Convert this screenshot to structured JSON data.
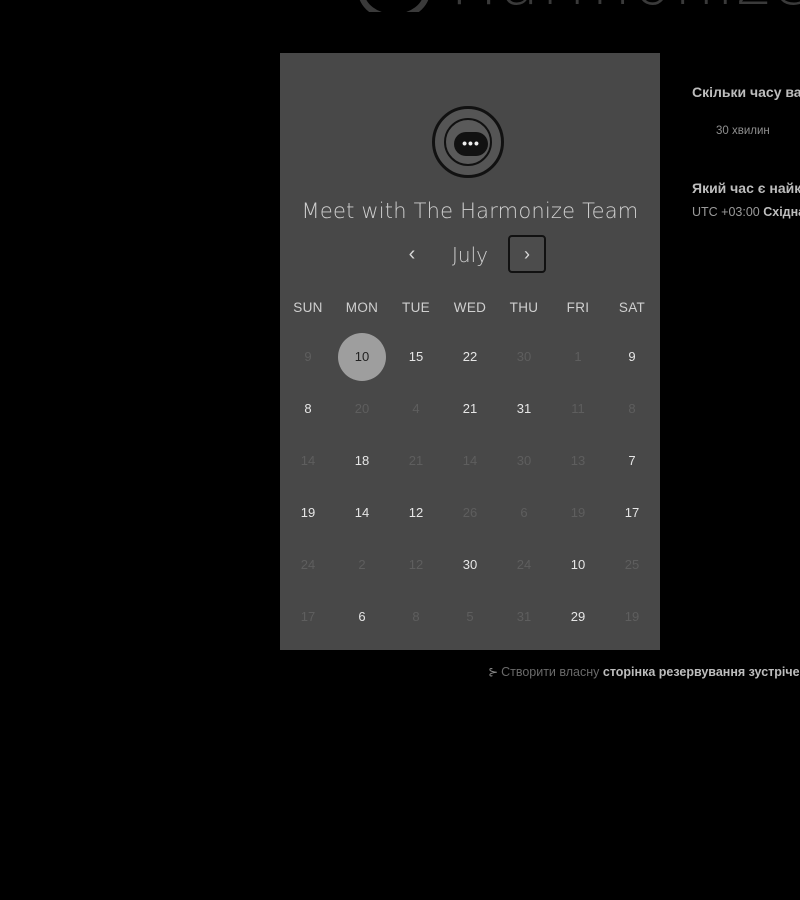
{
  "header": {
    "brand_text": "Harmonize"
  },
  "card": {
    "title": "Meet with The Harmonize Team",
    "logo_icon": "chat-bubble-icon",
    "logo_dots": "•••",
    "month": "July",
    "prev_label": "‹",
    "next_label": "›",
    "weekdays": [
      "SUN",
      "MON",
      "TUE",
      "WED",
      "THU",
      "FRI",
      "SAT"
    ],
    "weeks": [
      [
        {
          "d": "9",
          "a": false
        },
        {
          "d": "10",
          "a": true,
          "sel": true
        },
        {
          "d": "15",
          "a": true
        },
        {
          "d": "22",
          "a": true
        },
        {
          "d": "30",
          "a": false
        },
        {
          "d": "1",
          "a": false
        },
        {
          "d": "9",
          "a": true
        }
      ],
      [
        {
          "d": "8",
          "a": true
        },
        {
          "d": "20",
          "a": false
        },
        {
          "d": "4",
          "a": false
        },
        {
          "d": "21",
          "a": true
        },
        {
          "d": "31",
          "a": true
        },
        {
          "d": "11",
          "a": false
        },
        {
          "d": "8",
          "a": false
        }
      ],
      [
        {
          "d": "14",
          "a": false
        },
        {
          "d": "18",
          "a": true
        },
        {
          "d": "21",
          "a": false
        },
        {
          "d": "14",
          "a": false
        },
        {
          "d": "30",
          "a": false
        },
        {
          "d": "13",
          "a": false
        },
        {
          "d": "7",
          "a": true
        }
      ],
      [
        {
          "d": "19",
          "a": true
        },
        {
          "d": "14",
          "a": true
        },
        {
          "d": "12",
          "a": true
        },
        {
          "d": "26",
          "a": false
        },
        {
          "d": "6",
          "a": false
        },
        {
          "d": "19",
          "a": false
        },
        {
          "d": "17",
          "a": true
        }
      ],
      [
        {
          "d": "24",
          "a": false
        },
        {
          "d": "2",
          "a": false
        },
        {
          "d": "12",
          "a": false
        },
        {
          "d": "30",
          "a": true
        },
        {
          "d": "24",
          "a": false
        },
        {
          "d": "10",
          "a": true
        },
        {
          "d": "25",
          "a": false
        }
      ],
      [
        {
          "d": "17",
          "a": false
        },
        {
          "d": "6",
          "a": true
        },
        {
          "d": "8",
          "a": false
        },
        {
          "d": "5",
          "a": false
        },
        {
          "d": "31",
          "a": false
        },
        {
          "d": "29",
          "a": true
        },
        {
          "d": "19",
          "a": false
        }
      ]
    ]
  },
  "details": {
    "duration_question": "Скільки часу вам потрібно?",
    "duration_value": "30 хвилин",
    "time_question": "Який час є найкращим?",
    "timezone_prefix": "UTC +03:00",
    "timezone_name": "Східна Європа"
  },
  "footer": {
    "icon": "sparkle-icon",
    "prefix": "Створити власну",
    "link": "сторінка резервування зустрічей"
  }
}
